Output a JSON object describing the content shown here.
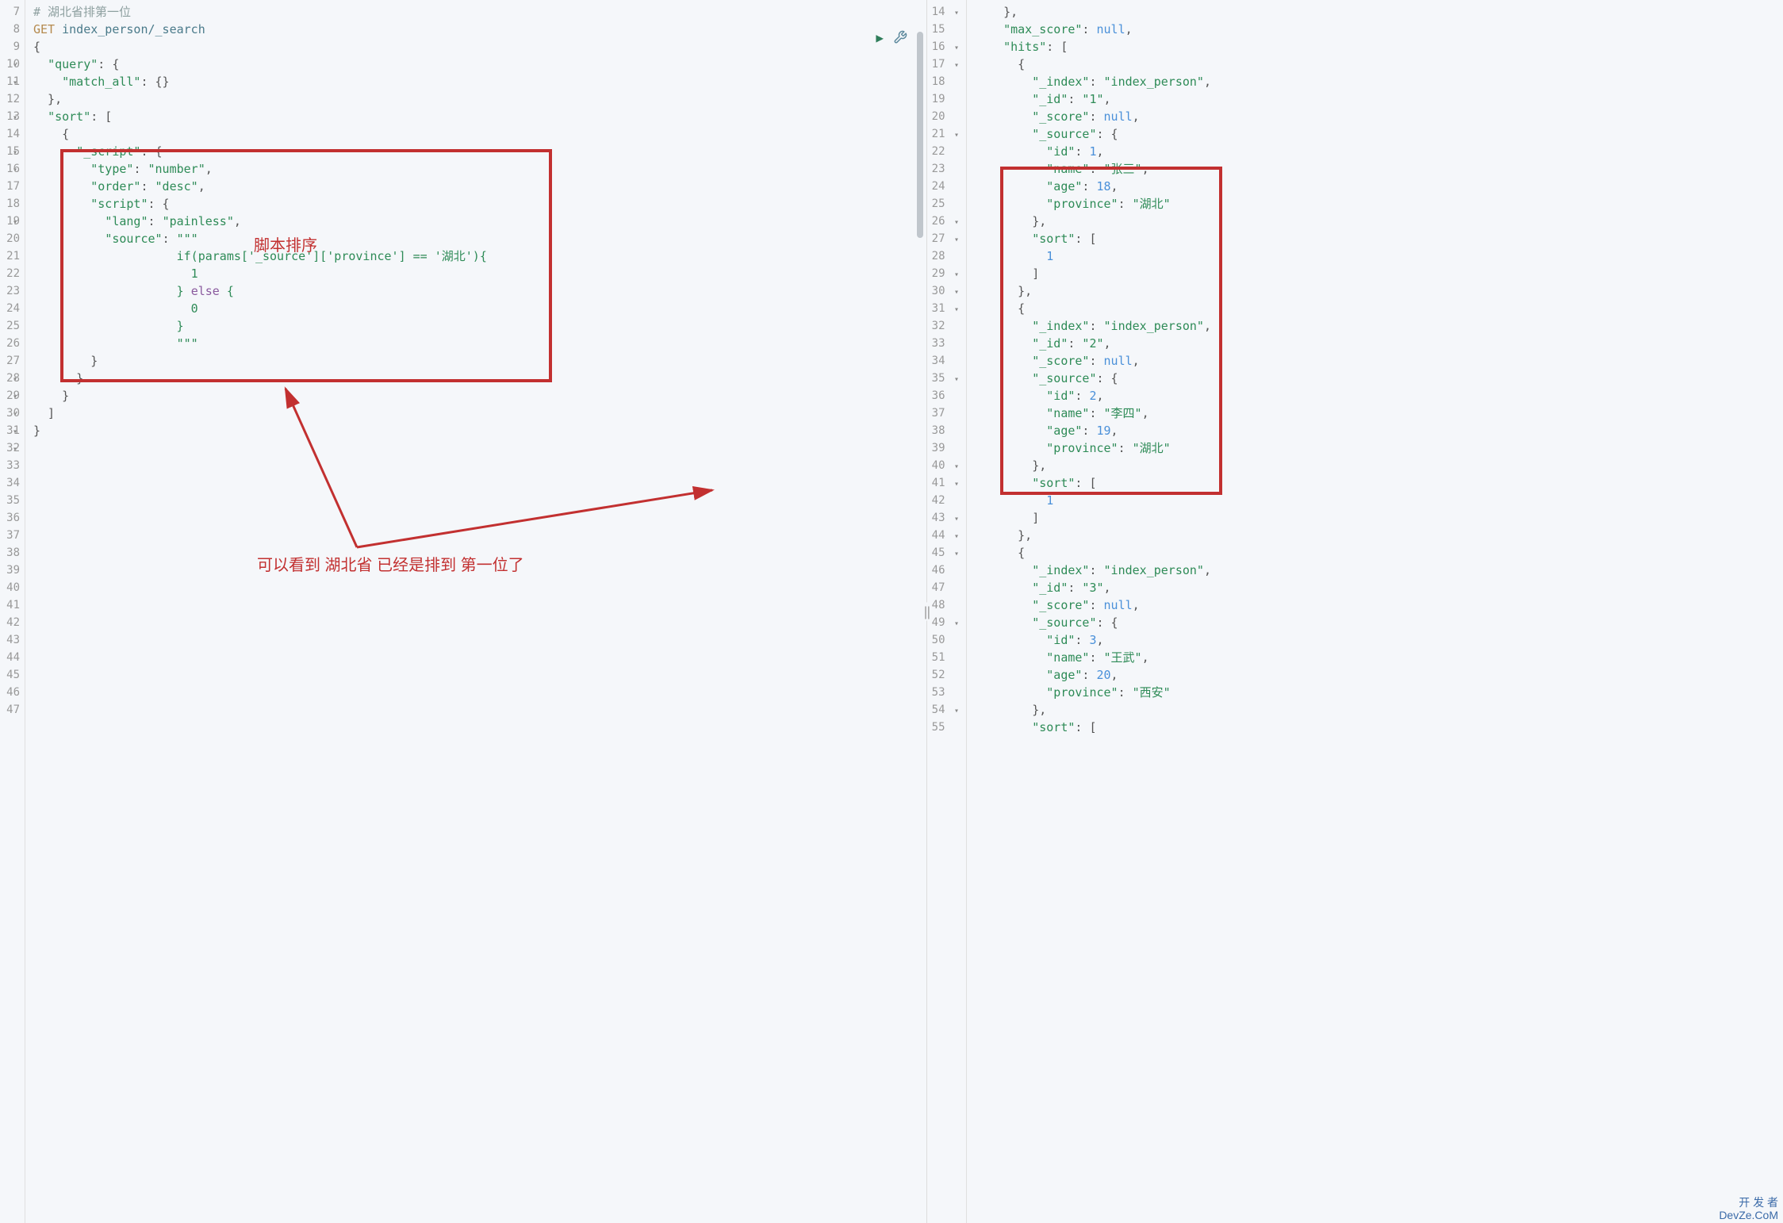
{
  "left_gutter_start": 7,
  "right_gutter_start": 14,
  "left_lines": [
    [
      {
        "cls": "tok-comment",
        "txt": "# 湖北省排第一位"
      }
    ],
    [
      {
        "cls": "tok-method",
        "txt": "GET "
      },
      {
        "cls": "tok-path",
        "txt": "index_person/_search"
      }
    ],
    [
      {
        "cls": "tok-punct",
        "txt": "{"
      }
    ],
    [
      {
        "cls": "tok-punct",
        "txt": "  "
      },
      {
        "cls": "tok-key",
        "txt": "\"query\""
      },
      {
        "cls": "tok-punct",
        "txt": ": {"
      }
    ],
    [
      {
        "cls": "tok-punct",
        "txt": "    "
      },
      {
        "cls": "tok-key",
        "txt": "\"match_all\""
      },
      {
        "cls": "tok-punct",
        "txt": ": {}"
      }
    ],
    [
      {
        "cls": "tok-punct",
        "txt": "  },"
      }
    ],
    [
      {
        "cls": "tok-punct",
        "txt": "  "
      },
      {
        "cls": "tok-key",
        "txt": "\"sort\""
      },
      {
        "cls": "tok-punct",
        "txt": ": ["
      }
    ],
    [
      {
        "cls": "tok-punct",
        "txt": "    {"
      }
    ],
    [
      {
        "cls": "tok-punct",
        "txt": "      "
      },
      {
        "cls": "tok-key",
        "txt": "\"_script\""
      },
      {
        "cls": "tok-punct",
        "txt": ": {"
      }
    ],
    [
      {
        "cls": "tok-punct",
        "txt": "        "
      },
      {
        "cls": "tok-key",
        "txt": "\"type\""
      },
      {
        "cls": "tok-punct",
        "txt": ": "
      },
      {
        "cls": "tok-string",
        "txt": "\"number\""
      },
      {
        "cls": "tok-punct",
        "txt": ","
      }
    ],
    [
      {
        "cls": "tok-punct",
        "txt": "        "
      },
      {
        "cls": "tok-key",
        "txt": "\"order\""
      },
      {
        "cls": "tok-punct",
        "txt": ": "
      },
      {
        "cls": "tok-string",
        "txt": "\"desc\""
      },
      {
        "cls": "tok-punct",
        "txt": ","
      }
    ],
    [
      {
        "cls": "tok-punct",
        "txt": "        "
      },
      {
        "cls": "tok-key",
        "txt": "\"script\""
      },
      {
        "cls": "tok-punct",
        "txt": ": {"
      }
    ],
    [
      {
        "cls": "tok-punct",
        "txt": "          "
      },
      {
        "cls": "tok-key",
        "txt": "\"lang\""
      },
      {
        "cls": "tok-punct",
        "txt": ": "
      },
      {
        "cls": "tok-string",
        "txt": "\"painless\""
      },
      {
        "cls": "tok-punct",
        "txt": ","
      }
    ],
    [
      {
        "cls": "tok-punct",
        "txt": "          "
      },
      {
        "cls": "tok-key",
        "txt": "\"source\""
      },
      {
        "cls": "tok-punct",
        "txt": ": "
      },
      {
        "cls": "tok-string",
        "txt": "\"\"\""
      }
    ],
    [
      {
        "cls": "tok-string",
        "txt": "                    if(params['_source']['province'] == '湖北'){"
      }
    ],
    [
      {
        "cls": "tok-string",
        "txt": "                      1"
      }
    ],
    [
      {
        "cls": "tok-string",
        "txt": "                    } "
      },
      {
        "cls": "tok-keyword",
        "txt": "else"
      },
      {
        "cls": "tok-string",
        "txt": " {"
      }
    ],
    [
      {
        "cls": "tok-string",
        "txt": "                      0"
      }
    ],
    [
      {
        "cls": "tok-string",
        "txt": "                    }"
      }
    ],
    [
      {
        "cls": "tok-string",
        "txt": "                    \"\"\""
      }
    ],
    [
      {
        "cls": "tok-punct",
        "txt": "        }"
      }
    ],
    [
      {
        "cls": "tok-punct",
        "txt": "      }"
      }
    ],
    [
      {
        "cls": "tok-punct",
        "txt": "    }"
      }
    ],
    [
      {
        "cls": "tok-punct",
        "txt": "  ]"
      }
    ],
    [
      {
        "cls": "tok-punct",
        "txt": "}"
      }
    ],
    [],
    [],
    [],
    [],
    [],
    [],
    [],
    [],
    [],
    [],
    [],
    [],
    [],
    [],
    [],
    []
  ],
  "left_fold_rows": [
    3,
    4,
    6,
    8,
    9,
    12,
    21,
    22,
    23,
    24,
    25
  ],
  "right_lines": [
    [
      {
        "cls": "tok-punct",
        "txt": "    },"
      }
    ],
    [
      {
        "cls": "tok-punct",
        "txt": "    "
      },
      {
        "cls": "tok-key",
        "txt": "\"max_score\""
      },
      {
        "cls": "tok-punct",
        "txt": ": "
      },
      {
        "cls": "tok-null",
        "txt": "null"
      },
      {
        "cls": "tok-punct",
        "txt": ","
      }
    ],
    [
      {
        "cls": "tok-punct",
        "txt": "    "
      },
      {
        "cls": "tok-key",
        "txt": "\"hits\""
      },
      {
        "cls": "tok-punct",
        "txt": ": ["
      }
    ],
    [
      {
        "cls": "tok-punct",
        "txt": "      {"
      }
    ],
    [
      {
        "cls": "tok-punct",
        "txt": "        "
      },
      {
        "cls": "tok-key",
        "txt": "\"_index\""
      },
      {
        "cls": "tok-punct",
        "txt": ": "
      },
      {
        "cls": "tok-string",
        "txt": "\"index_person\""
      },
      {
        "cls": "tok-punct",
        "txt": ","
      }
    ],
    [
      {
        "cls": "tok-punct",
        "txt": "        "
      },
      {
        "cls": "tok-key",
        "txt": "\"_id\""
      },
      {
        "cls": "tok-punct",
        "txt": ": "
      },
      {
        "cls": "tok-string",
        "txt": "\"1\""
      },
      {
        "cls": "tok-punct",
        "txt": ","
      }
    ],
    [
      {
        "cls": "tok-punct",
        "txt": "        "
      },
      {
        "cls": "tok-key",
        "txt": "\"_score\""
      },
      {
        "cls": "tok-punct",
        "txt": ": "
      },
      {
        "cls": "tok-null",
        "txt": "null"
      },
      {
        "cls": "tok-punct",
        "txt": ","
      }
    ],
    [
      {
        "cls": "tok-punct",
        "txt": "        "
      },
      {
        "cls": "tok-key",
        "txt": "\"_source\""
      },
      {
        "cls": "tok-punct",
        "txt": ": {"
      }
    ],
    [
      {
        "cls": "tok-punct",
        "txt": "          "
      },
      {
        "cls": "tok-key",
        "txt": "\"id\""
      },
      {
        "cls": "tok-punct",
        "txt": ": "
      },
      {
        "cls": "tok-num",
        "txt": "1"
      },
      {
        "cls": "tok-punct",
        "txt": ","
      }
    ],
    [
      {
        "cls": "tok-punct",
        "txt": "          "
      },
      {
        "cls": "tok-key",
        "txt": "\"name\""
      },
      {
        "cls": "tok-punct",
        "txt": ": "
      },
      {
        "cls": "tok-string",
        "txt": "\"张三\""
      },
      {
        "cls": "tok-punct",
        "txt": ","
      }
    ],
    [
      {
        "cls": "tok-punct",
        "txt": "          "
      },
      {
        "cls": "tok-key",
        "txt": "\"age\""
      },
      {
        "cls": "tok-punct",
        "txt": ": "
      },
      {
        "cls": "tok-num",
        "txt": "18"
      },
      {
        "cls": "tok-punct",
        "txt": ","
      }
    ],
    [
      {
        "cls": "tok-punct",
        "txt": "          "
      },
      {
        "cls": "tok-key",
        "txt": "\"province\""
      },
      {
        "cls": "tok-punct",
        "txt": ": "
      },
      {
        "cls": "tok-string",
        "txt": "\"湖北\""
      }
    ],
    [
      {
        "cls": "tok-punct",
        "txt": "        },"
      }
    ],
    [
      {
        "cls": "tok-punct",
        "txt": "        "
      },
      {
        "cls": "tok-key",
        "txt": "\"sort\""
      },
      {
        "cls": "tok-punct",
        "txt": ": ["
      }
    ],
    [
      {
        "cls": "tok-punct",
        "txt": "          "
      },
      {
        "cls": "tok-num",
        "txt": "1"
      }
    ],
    [
      {
        "cls": "tok-punct",
        "txt": "        ]"
      }
    ],
    [
      {
        "cls": "tok-punct",
        "txt": "      },"
      }
    ],
    [
      {
        "cls": "tok-punct",
        "txt": "      {"
      }
    ],
    [
      {
        "cls": "tok-punct",
        "txt": "        "
      },
      {
        "cls": "tok-key",
        "txt": "\"_index\""
      },
      {
        "cls": "tok-punct",
        "txt": ": "
      },
      {
        "cls": "tok-string",
        "txt": "\"index_person\""
      },
      {
        "cls": "tok-punct",
        "txt": ","
      }
    ],
    [
      {
        "cls": "tok-punct",
        "txt": "        "
      },
      {
        "cls": "tok-key",
        "txt": "\"_id\""
      },
      {
        "cls": "tok-punct",
        "txt": ": "
      },
      {
        "cls": "tok-string",
        "txt": "\"2\""
      },
      {
        "cls": "tok-punct",
        "txt": ","
      }
    ],
    [
      {
        "cls": "tok-punct",
        "txt": "        "
      },
      {
        "cls": "tok-key",
        "txt": "\"_score\""
      },
      {
        "cls": "tok-punct",
        "txt": ": "
      },
      {
        "cls": "tok-null",
        "txt": "null"
      },
      {
        "cls": "tok-punct",
        "txt": ","
      }
    ],
    [
      {
        "cls": "tok-punct",
        "txt": "        "
      },
      {
        "cls": "tok-key",
        "txt": "\"_source\""
      },
      {
        "cls": "tok-punct",
        "txt": ": {"
      }
    ],
    [
      {
        "cls": "tok-punct",
        "txt": "          "
      },
      {
        "cls": "tok-key",
        "txt": "\"id\""
      },
      {
        "cls": "tok-punct",
        "txt": ": "
      },
      {
        "cls": "tok-num",
        "txt": "2"
      },
      {
        "cls": "tok-punct",
        "txt": ","
      }
    ],
    [
      {
        "cls": "tok-punct",
        "txt": "          "
      },
      {
        "cls": "tok-key",
        "txt": "\"name\""
      },
      {
        "cls": "tok-punct",
        "txt": ": "
      },
      {
        "cls": "tok-string",
        "txt": "\"李四\""
      },
      {
        "cls": "tok-punct",
        "txt": ","
      }
    ],
    [
      {
        "cls": "tok-punct",
        "txt": "          "
      },
      {
        "cls": "tok-key",
        "txt": "\"age\""
      },
      {
        "cls": "tok-punct",
        "txt": ": "
      },
      {
        "cls": "tok-num",
        "txt": "19"
      },
      {
        "cls": "tok-punct",
        "txt": ","
      }
    ],
    [
      {
        "cls": "tok-punct",
        "txt": "          "
      },
      {
        "cls": "tok-key",
        "txt": "\"province\""
      },
      {
        "cls": "tok-punct",
        "txt": ": "
      },
      {
        "cls": "tok-string",
        "txt": "\"湖北\""
      }
    ],
    [
      {
        "cls": "tok-punct",
        "txt": "        },"
      }
    ],
    [
      {
        "cls": "tok-punct",
        "txt": "        "
      },
      {
        "cls": "tok-key",
        "txt": "\"sort\""
      },
      {
        "cls": "tok-punct",
        "txt": ": ["
      }
    ],
    [
      {
        "cls": "tok-punct",
        "txt": "          "
      },
      {
        "cls": "tok-num",
        "txt": "1"
      }
    ],
    [
      {
        "cls": "tok-punct",
        "txt": "        ]"
      }
    ],
    [
      {
        "cls": "tok-punct",
        "txt": "      },"
      }
    ],
    [
      {
        "cls": "tok-punct",
        "txt": "      {"
      }
    ],
    [
      {
        "cls": "tok-punct",
        "txt": "        "
      },
      {
        "cls": "tok-key",
        "txt": "\"_index\""
      },
      {
        "cls": "tok-punct",
        "txt": ": "
      },
      {
        "cls": "tok-string",
        "txt": "\"index_person\""
      },
      {
        "cls": "tok-punct",
        "txt": ","
      }
    ],
    [
      {
        "cls": "tok-punct",
        "txt": "        "
      },
      {
        "cls": "tok-key",
        "txt": "\"_id\""
      },
      {
        "cls": "tok-punct",
        "txt": ": "
      },
      {
        "cls": "tok-string",
        "txt": "\"3\""
      },
      {
        "cls": "tok-punct",
        "txt": ","
      }
    ],
    [
      {
        "cls": "tok-punct",
        "txt": "        "
      },
      {
        "cls": "tok-key",
        "txt": "\"_score\""
      },
      {
        "cls": "tok-punct",
        "txt": ": "
      },
      {
        "cls": "tok-null",
        "txt": "null"
      },
      {
        "cls": "tok-punct",
        "txt": ","
      }
    ],
    [
      {
        "cls": "tok-punct",
        "txt": "        "
      },
      {
        "cls": "tok-key",
        "txt": "\"_source\""
      },
      {
        "cls": "tok-punct",
        "txt": ": {"
      }
    ],
    [
      {
        "cls": "tok-punct",
        "txt": "          "
      },
      {
        "cls": "tok-key",
        "txt": "\"id\""
      },
      {
        "cls": "tok-punct",
        "txt": ": "
      },
      {
        "cls": "tok-num",
        "txt": "3"
      },
      {
        "cls": "tok-punct",
        "txt": ","
      }
    ],
    [
      {
        "cls": "tok-punct",
        "txt": "          "
      },
      {
        "cls": "tok-key",
        "txt": "\"name\""
      },
      {
        "cls": "tok-punct",
        "txt": ": "
      },
      {
        "cls": "tok-string",
        "txt": "\"王武\""
      },
      {
        "cls": "tok-punct",
        "txt": ","
      }
    ],
    [
      {
        "cls": "tok-punct",
        "txt": "          "
      },
      {
        "cls": "tok-key",
        "txt": "\"age\""
      },
      {
        "cls": "tok-punct",
        "txt": ": "
      },
      {
        "cls": "tok-num",
        "txt": "20"
      },
      {
        "cls": "tok-punct",
        "txt": ","
      }
    ],
    [
      {
        "cls": "tok-punct",
        "txt": "          "
      },
      {
        "cls": "tok-key",
        "txt": "\"province\""
      },
      {
        "cls": "tok-punct",
        "txt": ": "
      },
      {
        "cls": "tok-string",
        "txt": "\"西安\""
      }
    ],
    [
      {
        "cls": "tok-punct",
        "txt": "        },"
      }
    ],
    [
      {
        "cls": "tok-punct",
        "txt": "        "
      },
      {
        "cls": "tok-key",
        "txt": "\"sort\""
      },
      {
        "cls": "tok-punct",
        "txt": ": ["
      }
    ]
  ],
  "right_fold_rows": [
    1,
    3,
    4,
    8,
    13,
    14,
    16,
    17,
    18,
    22,
    27,
    28,
    30,
    31,
    32,
    36,
    41
  ],
  "annot1": "脚本排序",
  "annot2": "可以看到 湖北省 已经是排到 第一位了",
  "watermark_line1": "开 发 者",
  "watermark_line2": "DevZe.CoM"
}
